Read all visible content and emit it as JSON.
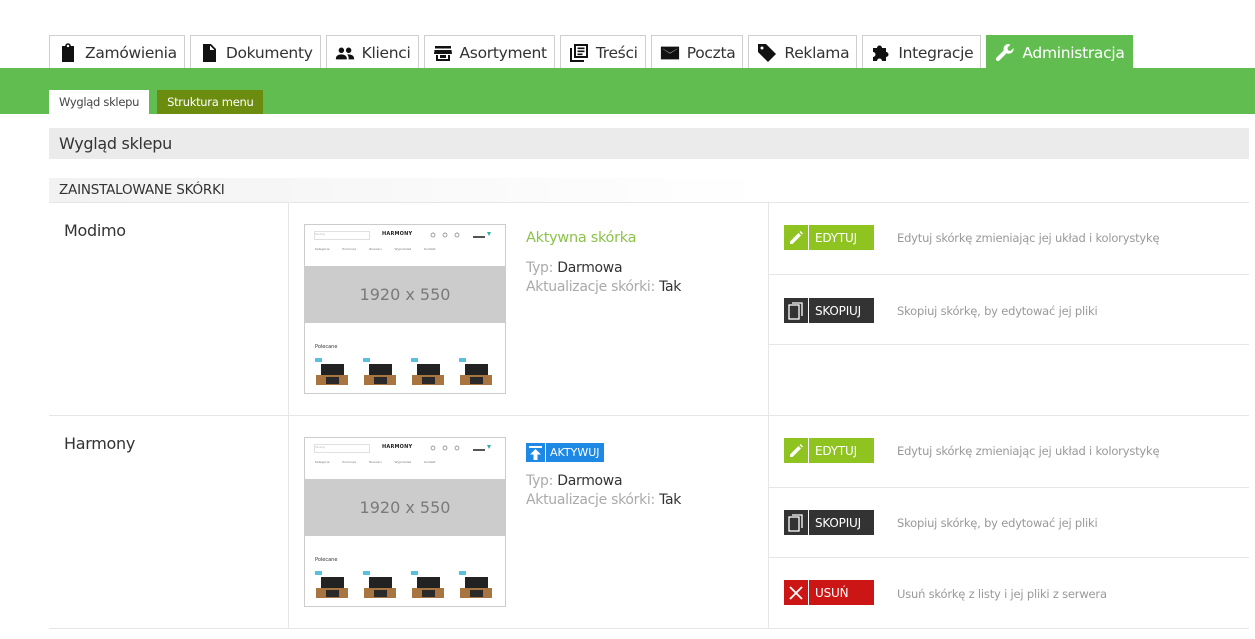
{
  "nav": {
    "tabs": [
      {
        "label": "Zamówienia",
        "icon": "clipboard-icon"
      },
      {
        "label": "Dokumenty",
        "icon": "document-icon"
      },
      {
        "label": "Klienci",
        "icon": "people-icon"
      },
      {
        "label": "Asortyment",
        "icon": "store-icon"
      },
      {
        "label": "Treści",
        "icon": "content-icon"
      },
      {
        "label": "Poczta",
        "icon": "envelope-icon"
      },
      {
        "label": "Reklama",
        "icon": "tag-icon"
      },
      {
        "label": "Integracje",
        "icon": "puzzle-icon"
      },
      {
        "label": "Administracja",
        "icon": "wrench-icon",
        "active": true
      }
    ],
    "subtabs": [
      {
        "label": "Wygląd sklepu",
        "active": true
      },
      {
        "label": "Struktura menu",
        "active": false
      }
    ]
  },
  "page": {
    "title": "Wygląd sklepu",
    "section": "ZAINSTALOWANE SKÓRKI"
  },
  "thumbnail": {
    "logo": "HARMONY",
    "hero_text": "1920 x 550",
    "section_label": "Polecane",
    "search_text": "Szukaj",
    "menu_text": "Kategorie Promocje Nowości Wyprzedaż Kontakt",
    "phone_text": "0 000 00 00"
  },
  "skins": [
    {
      "name": "Modimo",
      "active": true,
      "active_label": "Aktywna skórka",
      "type_label": "Typ:",
      "type_value": "Darmowa",
      "update_label": "Aktualizacje skórki:",
      "update_value": "Tak",
      "actions": [
        {
          "label": "EDYTUJ",
          "desc": "Edytuj skórkę zmieniając jej układ i kolorystykę",
          "kind": "edit"
        },
        {
          "label": "SKOPIUJ",
          "desc": "Skopiuj skórkę, by edytować jej pliki",
          "kind": "copy"
        }
      ]
    },
    {
      "name": "Harmony",
      "active": false,
      "activate_label": "AKTYWUJ",
      "type_label": "Typ:",
      "type_value": "Darmowa",
      "update_label": "Aktualizacje skórki:",
      "update_value": "Tak",
      "actions": [
        {
          "label": "EDYTUJ",
          "desc": "Edytuj skórkę zmieniając jej układ i kolorystykę",
          "kind": "edit"
        },
        {
          "label": "SKOPIUJ",
          "desc": "Skopiuj skórkę, by edytować jej pliki",
          "kind": "copy"
        },
        {
          "label": "USUŃ",
          "desc": "Usuń skórkę z listy i jej pliki z serwera",
          "kind": "delete"
        }
      ]
    }
  ],
  "colors": {
    "accent_green": "#61bd4f",
    "subtab_olive": "#6b8c0e",
    "edit_green": "#8fc31f",
    "active_text_green": "#8bc34a",
    "activate_blue": "#1e88e5",
    "delete_red": "#cc1616",
    "copy_dark": "#333333"
  }
}
